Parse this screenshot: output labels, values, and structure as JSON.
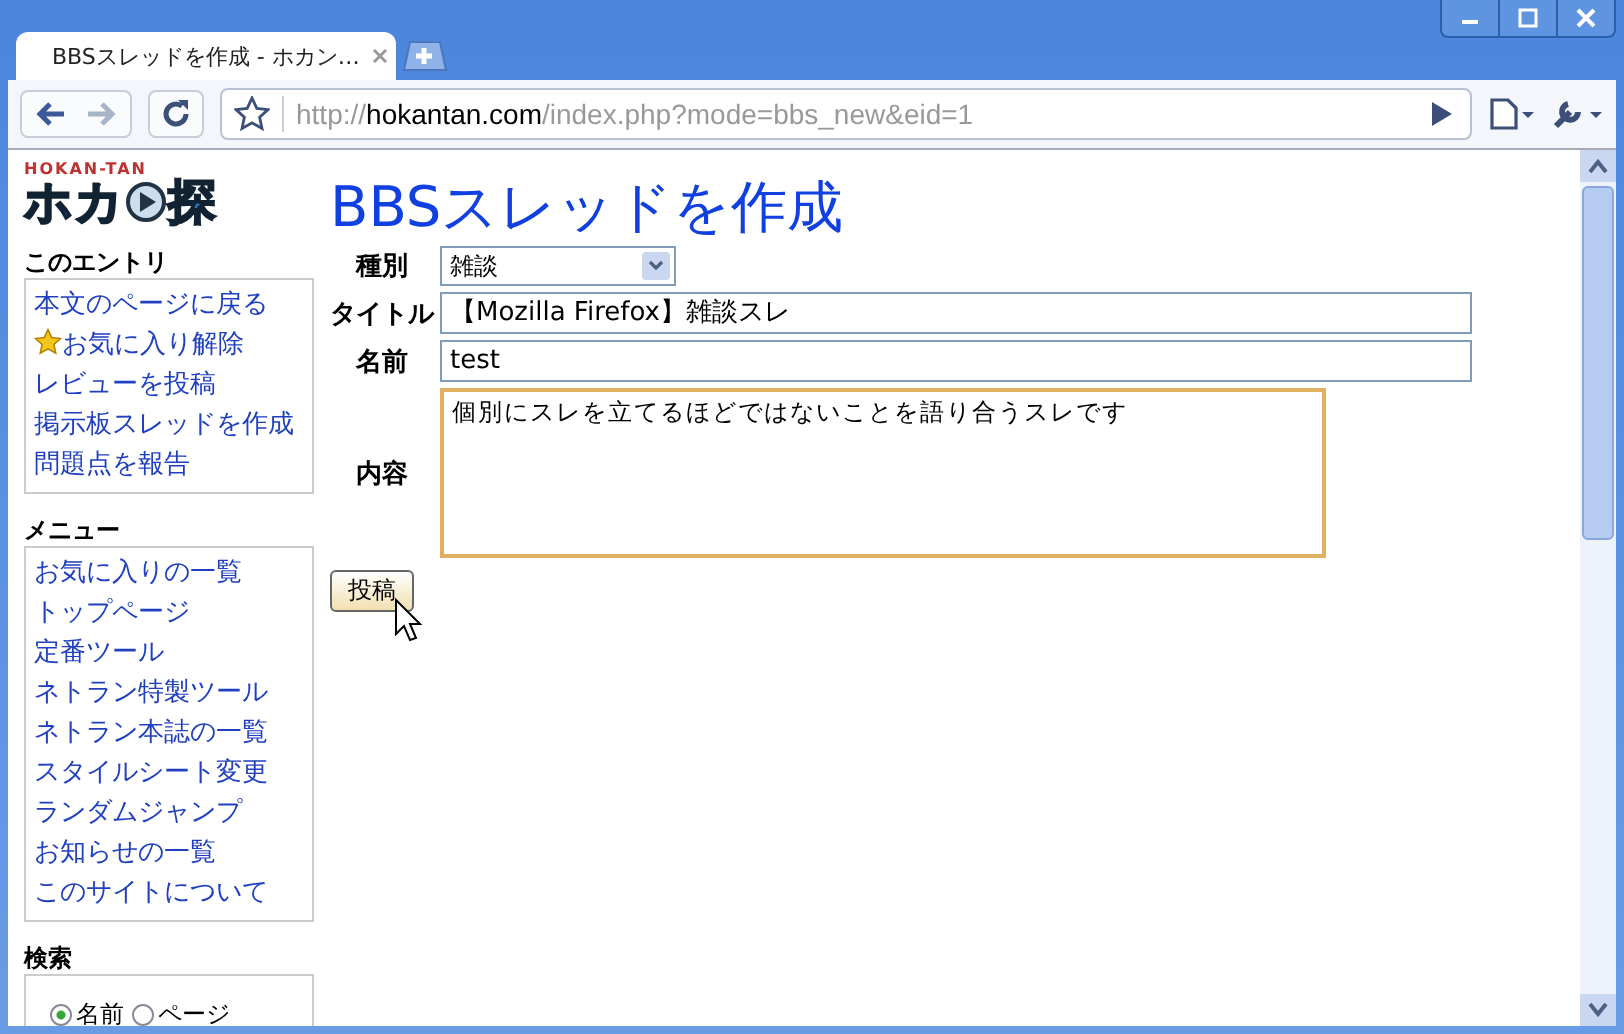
{
  "window": {
    "buttons": [
      {
        "kind": "minimize"
      },
      {
        "kind": "maximize"
      },
      {
        "kind": "close"
      }
    ]
  },
  "tabs": [
    {
      "title": "BBSスレッドを作成 - ホカン…",
      "selected": true
    }
  ],
  "address_bar": {
    "scheme": "http://",
    "host": "hokantan.com",
    "path": "/index.php?mode=bbs_new&eid=1"
  },
  "logo": {
    "small": "HOKAN-TAN",
    "left": "ホカ",
    "right": "探"
  },
  "sidebar": [
    {
      "heading": "このエントリ",
      "items": [
        {
          "label": "本文のページに戻る",
          "kind": "link"
        },
        {
          "label": "お気に入り解除",
          "kind": "star"
        },
        {
          "label": "レビューを投稿",
          "kind": "link"
        },
        {
          "label": "掲示板スレッドを作成",
          "kind": "link"
        },
        {
          "label": "問題点を報告",
          "kind": "link"
        }
      ]
    },
    {
      "heading": "メニュー",
      "items": [
        {
          "label": "お気に入りの一覧",
          "kind": "link"
        },
        {
          "label": "トップページ",
          "kind": "link"
        },
        {
          "label": "定番ツール",
          "kind": "link"
        },
        {
          "label": "ネトラン特製ツール",
          "kind": "link"
        },
        {
          "label": "ネトラン本誌の一覧",
          "kind": "link"
        },
        {
          "label": "スタイルシート変更",
          "kind": "link"
        },
        {
          "label": "ランダムジャンプ",
          "kind": "link"
        },
        {
          "label": "お知らせの一覧",
          "kind": "link"
        },
        {
          "label": "このサイトについて",
          "kind": "link"
        }
      ]
    },
    {
      "heading": "検索",
      "radios": [
        {
          "label": "名前",
          "selected": true
        },
        {
          "label": "ページ",
          "selected": false
        }
      ]
    }
  ],
  "page_title": "BBSスレッドを作成",
  "form": [
    {
      "label": "種別",
      "kind": "select",
      "value": "雑談"
    },
    {
      "label": "タイトル",
      "kind": "input",
      "value": "【Mozilla Firefox】雑談スレ"
    },
    {
      "label": "名前",
      "kind": "input",
      "value": "test"
    },
    {
      "label": "内容",
      "kind": "textarea",
      "value": "個別にスレを立てるほどではないことを語り合うスレです"
    }
  ],
  "submit": "投稿"
}
